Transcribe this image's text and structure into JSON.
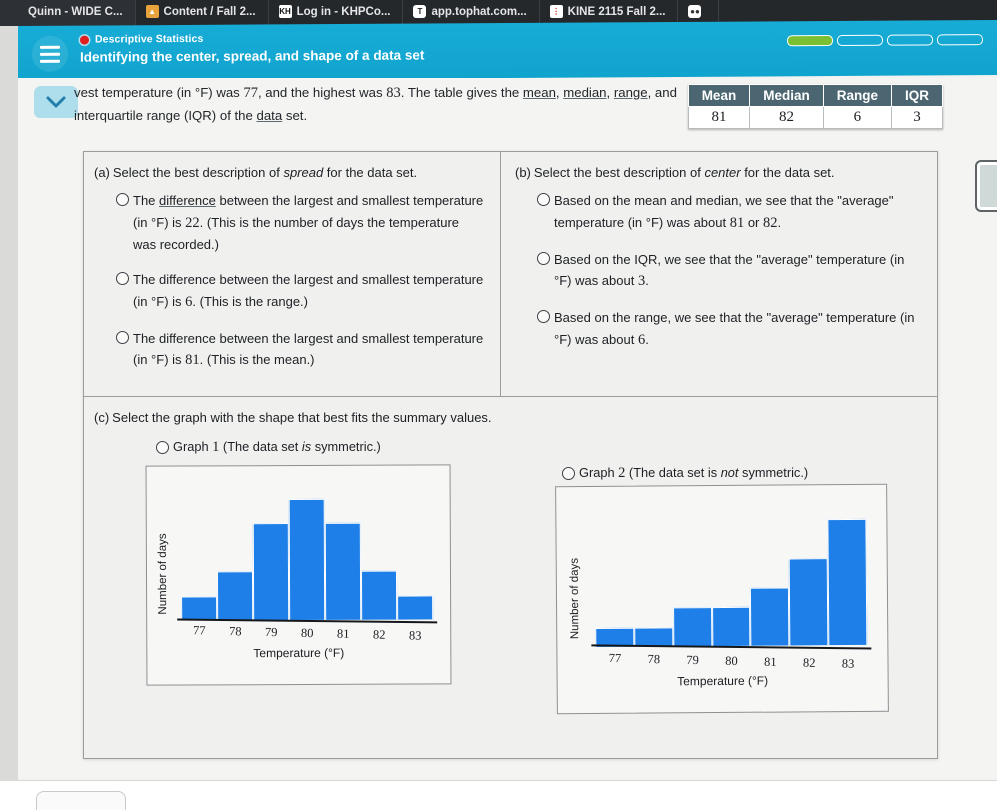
{
  "browser": {
    "tabs": [
      {
        "label": "Quinn - WIDE C...",
        "icon": "quinn-favicon",
        "glyph": ""
      },
      {
        "label": "Content / Fall 2...",
        "icon": "canvas-favicon",
        "glyph": "▲"
      },
      {
        "label": "Log in - KHPCo...",
        "icon": "khp-favicon",
        "glyph": "KH"
      },
      {
        "label": "app.tophat.com...",
        "icon": "tophat-favicon",
        "glyph": "T"
      },
      {
        "label": "KINE 2115 Fall 2...",
        "icon": "kine-favicon",
        "glyph": "⋮"
      },
      {
        "label": "",
        "icon": "generic-favicon",
        "glyph": "●●"
      }
    ]
  },
  "header": {
    "kicker": "Descriptive Statistics",
    "title": "Identifying the center, spread, and shape of a data set",
    "menu_icon": "hamburger-menu-icon",
    "record_icon": "record-dot-icon",
    "progress": {
      "total": 4,
      "completed": 1,
      "fill_color": "#7BBF33"
    }
  },
  "question": {
    "stem_part1": "vest temperature (in °F) was ",
    "stem_low": "77",
    "stem_part2": ", and the highest was ",
    "stem_high": "83",
    "stem_part3": ". The table gives the ",
    "link_mean": "mean",
    "stem_comma1": ", ",
    "link_median": "median",
    "stem_comma2": ",",
    "link_range": "range",
    "stem_part4": ", and interquartile range (IQR) of the ",
    "link_data": "data",
    "stem_part5": " set.",
    "collapse_icon": "chevron-down-icon"
  },
  "summary_table": {
    "headers": [
      "Mean",
      "Median",
      "Range",
      "IQR"
    ],
    "values": [
      "81",
      "82",
      "6",
      "3"
    ],
    "header_bg": "#4B6670"
  },
  "part_a": {
    "letter": "(a)",
    "prompt_pre": "Select the best description of ",
    "prompt_em": "spread",
    "prompt_post": " for the data set.",
    "options": [
      {
        "pre": "The ",
        "link": "difference",
        "post": " between the largest and smallest temperature (in °F) is ",
        "value": "22",
        "tail": ". (This is the number of days the temperature was recorded.)"
      },
      {
        "pre": "The difference between the largest and smallest temperature (in °F) is ",
        "link": "",
        "post": "",
        "value": "6",
        "tail": ". (This is the range.)"
      },
      {
        "pre": "The difference between the largest and smallest temperature (in °F) is ",
        "link": "",
        "post": "",
        "value": "81",
        "tail": ". (This is the mean.)"
      }
    ]
  },
  "part_b": {
    "letter": "(b)",
    "prompt_pre": "Select the best description of ",
    "prompt_em": "center",
    "prompt_post": " for the data set.",
    "options": [
      {
        "pre": "Based on the mean and median, we see that the \"average\" temperature (in °F) was about ",
        "value": "81",
        "mid": " or ",
        "value2": "82",
        "tail": "."
      },
      {
        "pre": "Based on the IQR, we see that the \"average\" temperature (in °F) was about ",
        "value": "3",
        "mid": "",
        "value2": "",
        "tail": "."
      },
      {
        "pre": "Based on the range, we see that the \"average\" temperature (in °F) was about ",
        "value": "6",
        "mid": "",
        "value2": "",
        "tail": "."
      }
    ]
  },
  "part_c": {
    "letter": "(c)",
    "prompt": "Select the graph with the shape that best fits the summary values.",
    "option1_pre": "Graph ",
    "option1_num": "1",
    "option1_mid": " (The data set ",
    "option1_em": "is",
    "option1_post": " symmetric.)",
    "option2_pre": "Graph ",
    "option2_num": "2",
    "option2_mid": " (The data set is ",
    "option2_em": "not",
    "option2_post": " symmetric.)"
  },
  "chart_data": [
    {
      "type": "bar",
      "name": "Graph 1",
      "title": "",
      "categories": [
        "77",
        "78",
        "79",
        "80",
        "81",
        "82",
        "83"
      ],
      "values": [
        1,
        2,
        4,
        5,
        4,
        2,
        1
      ],
      "xlabel": "Temperature (°F)",
      "ylabel": "Number of days",
      "ylim": [
        0,
        5.6
      ],
      "grid": false,
      "bar_color": "#1E7FE8",
      "shape": "symmetric"
    },
    {
      "type": "bar",
      "name": "Graph 2",
      "title": "",
      "categories": [
        "77",
        "78",
        "79",
        "80",
        "81",
        "82",
        "83"
      ],
      "values": [
        1,
        1,
        2,
        2,
        3,
        4.5,
        6.5
      ],
      "xlabel": "Temperature (°F)",
      "ylabel": "Number of days",
      "ylim": [
        0,
        7.2
      ],
      "grid": false,
      "bar_color": "#1E7FE8",
      "shape": "left-skewed"
    }
  ]
}
